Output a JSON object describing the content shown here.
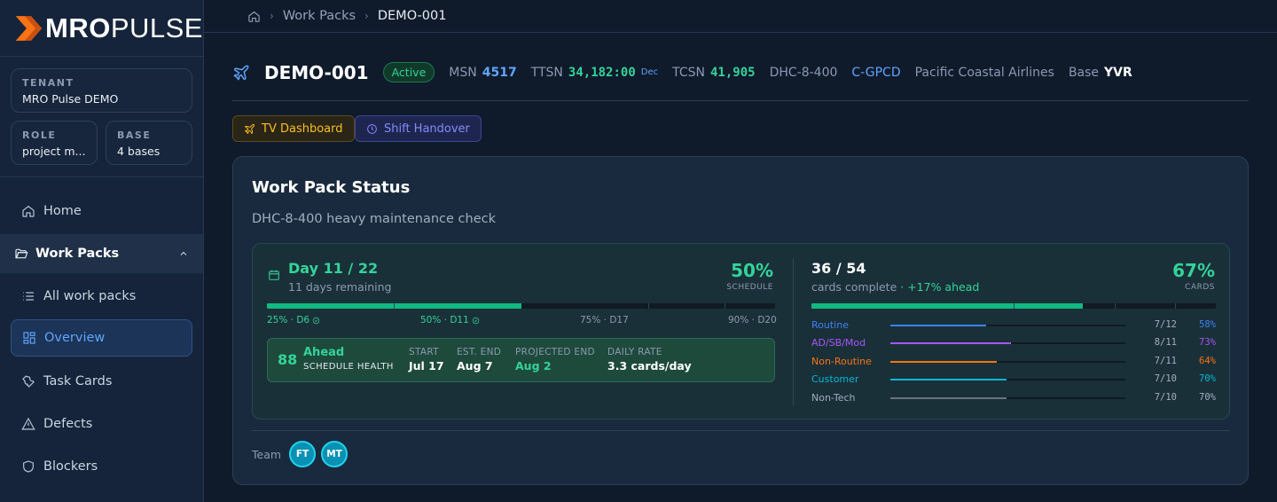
{
  "brand": {
    "part1": "MRO",
    "part2": "PULSE"
  },
  "sidebar": {
    "tenant_label": "TENANT",
    "tenant_value": "MRO Pulse DEMO",
    "role_label": "ROLE",
    "role_value": "project m...",
    "base_label": "BASE",
    "base_value": "4 bases",
    "home": "Home",
    "group": "Work Packs",
    "all": "All work packs",
    "overview": "Overview",
    "task_cards": "Task Cards",
    "defects": "Defects",
    "blockers": "Blockers"
  },
  "breadcrumb": {
    "level1": "Work Packs",
    "current": "DEMO-001"
  },
  "header": {
    "title": "DEMO-001",
    "status": "Active",
    "msn_label": "MSN",
    "msn_value": "4517",
    "ttsn_label": "TTSN",
    "ttsn_value": "34,182:00",
    "ttsn_unit": "Dec",
    "tcsn_label": "TCSN",
    "tcsn_value": "41,905",
    "aircraft_type": "DHC-8-400",
    "registration": "C-GPCD",
    "operator": "Pacific Coastal Airlines",
    "base_label": "Base",
    "base_value": "YVR"
  },
  "actions": {
    "tv": "TV Dashboard",
    "shift": "Shift Handover"
  },
  "status_panel": {
    "title": "Work Pack Status",
    "subtitle": "DHC-8-400 heavy maintenance check",
    "schedule": {
      "day": "Day 11 / 22",
      "remaining": "11 days remaining",
      "percent": "50%",
      "percent_caption": "SCHEDULE",
      "progress": 0.5,
      "milestones": [
        {
          "label": "25% · D6",
          "done": true
        },
        {
          "label": "50% · D11",
          "done": true
        },
        {
          "label": "75% · D17",
          "done": false
        },
        {
          "label": "90% · D20",
          "done": false
        }
      ]
    },
    "health": {
      "score": "88",
      "state": "Ahead",
      "caption": "SCHEDULE HEALTH",
      "start_label": "START",
      "start_value": "Jul 17",
      "end_label": "EST. END",
      "end_value": "Aug 7",
      "proj_label": "PROJECTED END",
      "proj_value": "Aug 2",
      "rate_label": "DAILY RATE",
      "rate_value": "3.3 cards/day"
    },
    "cards": {
      "count": "36 / 54",
      "sub": "cards complete",
      "ahead": "· +17% ahead",
      "percent": "67%",
      "percent_caption": "CARDS",
      "progress": 0.67,
      "categories": [
        {
          "name": "Routine",
          "count": "7/12",
          "pct": "58%",
          "value": 0.58,
          "color": "#3b82f6"
        },
        {
          "name": "AD/SB/Mod",
          "count": "8/11",
          "pct": "73%",
          "value": 0.73,
          "color": "#a855f7"
        },
        {
          "name": "Non-Routine",
          "count": "7/11",
          "pct": "64%",
          "value": 0.64,
          "color": "#f97316"
        },
        {
          "name": "Customer",
          "count": "7/10",
          "pct": "70%",
          "value": 0.7,
          "color": "#06b6d4"
        },
        {
          "name": "Non-Tech",
          "count": "7/10",
          "pct": "70%",
          "value": 0.7,
          "color": "#6b7280"
        }
      ]
    },
    "team": {
      "label": "Team",
      "members": [
        "FT",
        "MT"
      ]
    }
  }
}
